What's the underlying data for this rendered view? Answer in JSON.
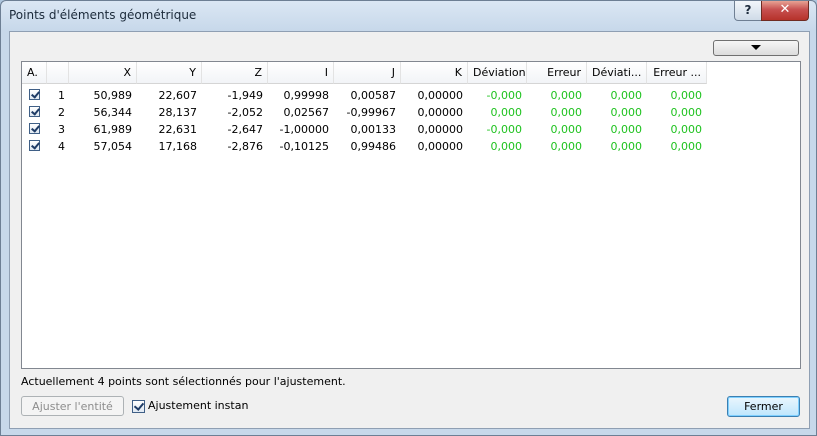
{
  "window": {
    "title": "Points d'éléments géométrique"
  },
  "titlebar": {
    "help_label": "?",
    "close_label": "✕"
  },
  "grid": {
    "columns": [
      "A.",
      "",
      "X",
      "Y",
      "Z",
      "I",
      "J",
      "K",
      "Déviation",
      "Erreur",
      "Déviati...",
      "Erreur ..."
    ],
    "rows": [
      {
        "checked": true,
        "cells": [
          "1",
          "50,989",
          "22,607",
          "-1,949",
          "0,99998",
          "0,00587",
          "0,00000",
          "-0,000",
          "0,000",
          "0,000",
          "0,000"
        ]
      },
      {
        "checked": true,
        "cells": [
          "2",
          "56,344",
          "28,137",
          "-2,052",
          "0,02567",
          "-0,99967",
          "0,00000",
          "0,000",
          "0,000",
          "0,000",
          "0,000"
        ]
      },
      {
        "checked": true,
        "cells": [
          "3",
          "61,989",
          "22,631",
          "-2,647",
          "-1,00000",
          "0,00133",
          "0,00000",
          "-0,000",
          "0,000",
          "0,000",
          "0,000"
        ]
      },
      {
        "checked": true,
        "cells": [
          "4",
          "57,054",
          "17,168",
          "-2,876",
          "-0,10125",
          "0,99486",
          "0,00000",
          "0,000",
          "0,000",
          "0,000",
          "0,000"
        ]
      }
    ]
  },
  "status": {
    "text": "Actuellement 4 points sont sélectionnés pour l'ajustement."
  },
  "footer": {
    "adjust_label": "Ajuster l'entité",
    "instant_label": "Ajustement instantané",
    "instant_checked": true,
    "close_label": "Fermer"
  },
  "colors": {
    "deviation_green": "#1fc21f"
  }
}
